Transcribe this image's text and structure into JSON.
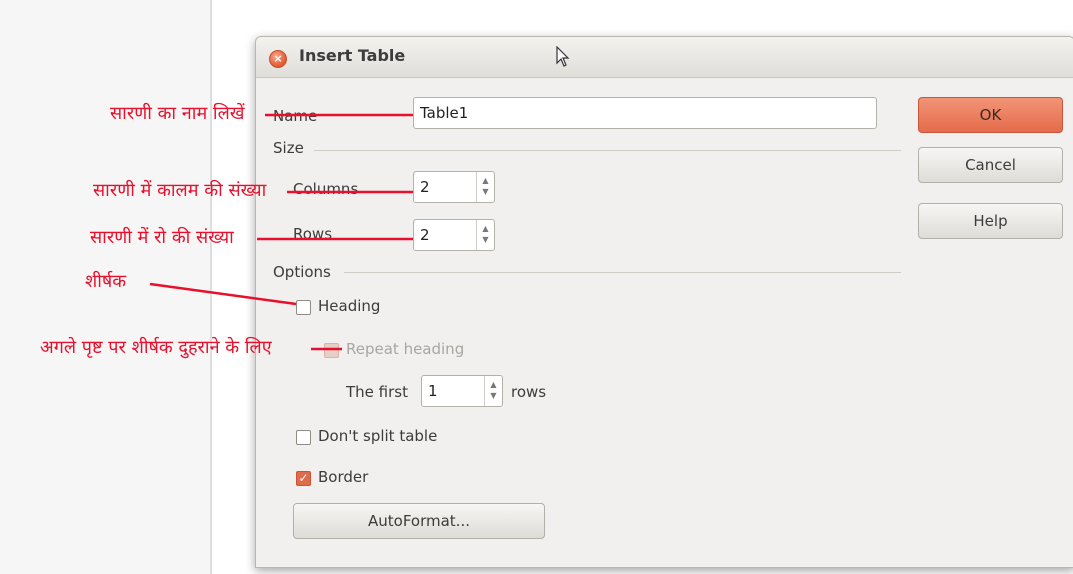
{
  "dialog": {
    "title": "Insert Table",
    "name_label": "Name",
    "name_value": "Table1",
    "size_header": "Size",
    "columns_label": "Columns",
    "columns_value": "2",
    "rows_label": "Rows",
    "rows_value": "2",
    "options_header": "Options",
    "heading_label": "Heading",
    "repeat_heading_label": "Repeat heading",
    "the_first_label": "The first",
    "the_first_value": "1",
    "rows_suffix": "rows",
    "dont_split_label": "Don't split table",
    "border_label": "Border",
    "autoformat_label": "AutoFormat...",
    "heading_checked": false,
    "repeat_heading_checked": true,
    "dont_split_checked": false,
    "border_checked": true
  },
  "buttons": {
    "ok": "OK",
    "cancel": "Cancel",
    "help": "Help"
  },
  "annotations": {
    "name": "सारणी का नाम लिखें",
    "columns": "सारणी में कालम की संख्या",
    "rows": "सारणी में रो की संख्या",
    "heading": "शीर्षक",
    "repeat_heading": "अगले पृष्ट पर शीर्षक दुहराने के लिए"
  },
  "colors": {
    "accent": "#e46c4b",
    "annotation": "#e8102c"
  }
}
